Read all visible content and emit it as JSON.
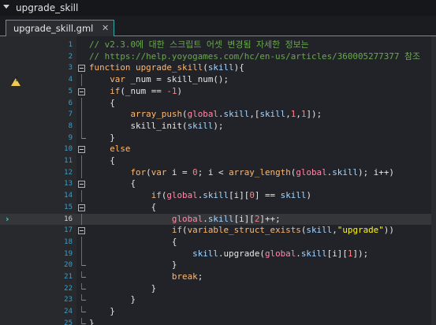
{
  "window": {
    "title": "upgrade_skill"
  },
  "tab": {
    "label": "upgrade_skill.gml",
    "close": "✕"
  },
  "editor": {
    "warning_line": 4,
    "current_line": 16,
    "lines": [
      {
        "n": "1",
        "tokens": [
          {
            "t": "// v2.3.0에 대한 스크립트 어셋 변경됨 자세한 정보는",
            "c": "comment"
          }
        ]
      },
      {
        "n": "2",
        "tokens": [
          {
            "t": "// https://help.yoyogames.com/hc/en-us/articles/360005277377 참조",
            "c": "comment"
          }
        ]
      },
      {
        "n": "3",
        "tokens": [
          {
            "t": "function",
            "c": "kw"
          },
          {
            "t": " ",
            "c": "op"
          },
          {
            "t": "upgrade_skill",
            "c": "fn"
          },
          {
            "t": "(",
            "c": "op"
          },
          {
            "t": "skill",
            "c": "res"
          },
          {
            "t": "){",
            "c": "op"
          }
        ]
      },
      {
        "n": "4",
        "tokens": [
          {
            "t": "    ",
            "c": "op"
          },
          {
            "t": "var",
            "c": "kw"
          },
          {
            "t": " _num = skill_num();",
            "c": "op"
          }
        ]
      },
      {
        "n": "5",
        "tokens": [
          {
            "t": "    ",
            "c": "op"
          },
          {
            "t": "if",
            "c": "kw"
          },
          {
            "t": "(_num == ",
            "c": "op"
          },
          {
            "t": "-1",
            "c": "num"
          },
          {
            "t": ")",
            "c": "op"
          }
        ]
      },
      {
        "n": "6",
        "tokens": [
          {
            "t": "    {",
            "c": "op"
          }
        ]
      },
      {
        "n": "7",
        "tokens": [
          {
            "t": "        ",
            "c": "op"
          },
          {
            "t": "array_push",
            "c": "fn"
          },
          {
            "t": "(",
            "c": "op"
          },
          {
            "t": "global",
            "c": "glob"
          },
          {
            "t": ".",
            "c": "op"
          },
          {
            "t": "skill",
            "c": "res"
          },
          {
            "t": ",[",
            "c": "op"
          },
          {
            "t": "skill",
            "c": "res"
          },
          {
            "t": ",",
            "c": "op"
          },
          {
            "t": "1",
            "c": "num"
          },
          {
            "t": ",",
            "c": "op"
          },
          {
            "t": "1",
            "c": "num"
          },
          {
            "t": "]);",
            "c": "op"
          }
        ]
      },
      {
        "n": "8",
        "tokens": [
          {
            "t": "        skill_init(",
            "c": "op"
          },
          {
            "t": "skill",
            "c": "res"
          },
          {
            "t": ");",
            "c": "op"
          }
        ]
      },
      {
        "n": "9",
        "tokens": [
          {
            "t": "    }",
            "c": "op"
          }
        ]
      },
      {
        "n": "10",
        "tokens": [
          {
            "t": "    ",
            "c": "op"
          },
          {
            "t": "else",
            "c": "kw"
          }
        ]
      },
      {
        "n": "11",
        "tokens": [
          {
            "t": "    {",
            "c": "op"
          }
        ]
      },
      {
        "n": "12",
        "tokens": [
          {
            "t": "        ",
            "c": "op"
          },
          {
            "t": "for",
            "c": "kw"
          },
          {
            "t": "(",
            "c": "op"
          },
          {
            "t": "var",
            "c": "kw"
          },
          {
            "t": " i = ",
            "c": "op"
          },
          {
            "t": "0",
            "c": "num"
          },
          {
            "t": "; i < ",
            "c": "op"
          },
          {
            "t": "array_length",
            "c": "fn"
          },
          {
            "t": "(",
            "c": "op"
          },
          {
            "t": "global",
            "c": "glob"
          },
          {
            "t": ".",
            "c": "op"
          },
          {
            "t": "skill",
            "c": "res"
          },
          {
            "t": "); i++)",
            "c": "op"
          }
        ]
      },
      {
        "n": "13",
        "tokens": [
          {
            "t": "        {",
            "c": "op"
          }
        ]
      },
      {
        "n": "14",
        "tokens": [
          {
            "t": "            ",
            "c": "op"
          },
          {
            "t": "if",
            "c": "kw"
          },
          {
            "t": "(",
            "c": "op"
          },
          {
            "t": "global",
            "c": "glob"
          },
          {
            "t": ".",
            "c": "op"
          },
          {
            "t": "skill",
            "c": "res"
          },
          {
            "t": "[i][",
            "c": "op"
          },
          {
            "t": "0",
            "c": "num"
          },
          {
            "t": "] == ",
            "c": "op"
          },
          {
            "t": "skill",
            "c": "res"
          },
          {
            "t": ")",
            "c": "op"
          }
        ]
      },
      {
        "n": "15",
        "tokens": [
          {
            "t": "            {",
            "c": "op"
          }
        ]
      },
      {
        "n": "16",
        "tokens": [
          {
            "t": "                ",
            "c": "op"
          },
          {
            "t": "global",
            "c": "glob"
          },
          {
            "t": ".",
            "c": "op"
          },
          {
            "t": "skill",
            "c": "res"
          },
          {
            "t": "[i][",
            "c": "op"
          },
          {
            "t": "2",
            "c": "num"
          },
          {
            "t": "]++;",
            "c": "op"
          }
        ]
      },
      {
        "n": "17",
        "tokens": [
          {
            "t": "                ",
            "c": "op"
          },
          {
            "t": "if",
            "c": "kw"
          },
          {
            "t": "(",
            "c": "op"
          },
          {
            "t": "variable_struct_exists",
            "c": "fn"
          },
          {
            "t": "(",
            "c": "op"
          },
          {
            "t": "skill",
            "c": "res"
          },
          {
            "t": ",",
            "c": "op"
          },
          {
            "t": "\"upgrade\"",
            "c": "str"
          },
          {
            "t": "))",
            "c": "op"
          }
        ]
      },
      {
        "n": "18",
        "tokens": [
          {
            "t": "                {",
            "c": "op"
          }
        ]
      },
      {
        "n": "19",
        "tokens": [
          {
            "t": "                    ",
            "c": "op"
          },
          {
            "t": "skill",
            "c": "res"
          },
          {
            "t": ".upgrade(",
            "c": "op"
          },
          {
            "t": "global",
            "c": "glob"
          },
          {
            "t": ".",
            "c": "op"
          },
          {
            "t": "skill",
            "c": "res"
          },
          {
            "t": "[i][",
            "c": "op"
          },
          {
            "t": "1",
            "c": "num"
          },
          {
            "t": "]);",
            "c": "op"
          }
        ]
      },
      {
        "n": "20",
        "tokens": [
          {
            "t": "                }",
            "c": "op"
          }
        ]
      },
      {
        "n": "21",
        "tokens": [
          {
            "t": "                ",
            "c": "op"
          },
          {
            "t": "break",
            "c": "kw"
          },
          {
            "t": ";",
            "c": "op"
          }
        ]
      },
      {
        "n": "22",
        "tokens": [
          {
            "t": "            }",
            "c": "op"
          }
        ]
      },
      {
        "n": "23",
        "tokens": [
          {
            "t": "        }",
            "c": "op"
          }
        ]
      },
      {
        "n": "24",
        "tokens": [
          {
            "t": "    }",
            "c": "op"
          }
        ]
      },
      {
        "n": "25",
        "tokens": [
          {
            "t": "}",
            "c": "op"
          }
        ]
      }
    ]
  },
  "colors": {
    "background": "#222328",
    "gutter": "#28292d",
    "accent": "#2fa8a8",
    "line_number": "#3f9ec8",
    "comment": "#6aa84f",
    "keyword": "#ffb871",
    "number": "#ff8080",
    "string": "#fcf320",
    "global": "#ff8aa9",
    "warning": "#f2c94c"
  }
}
